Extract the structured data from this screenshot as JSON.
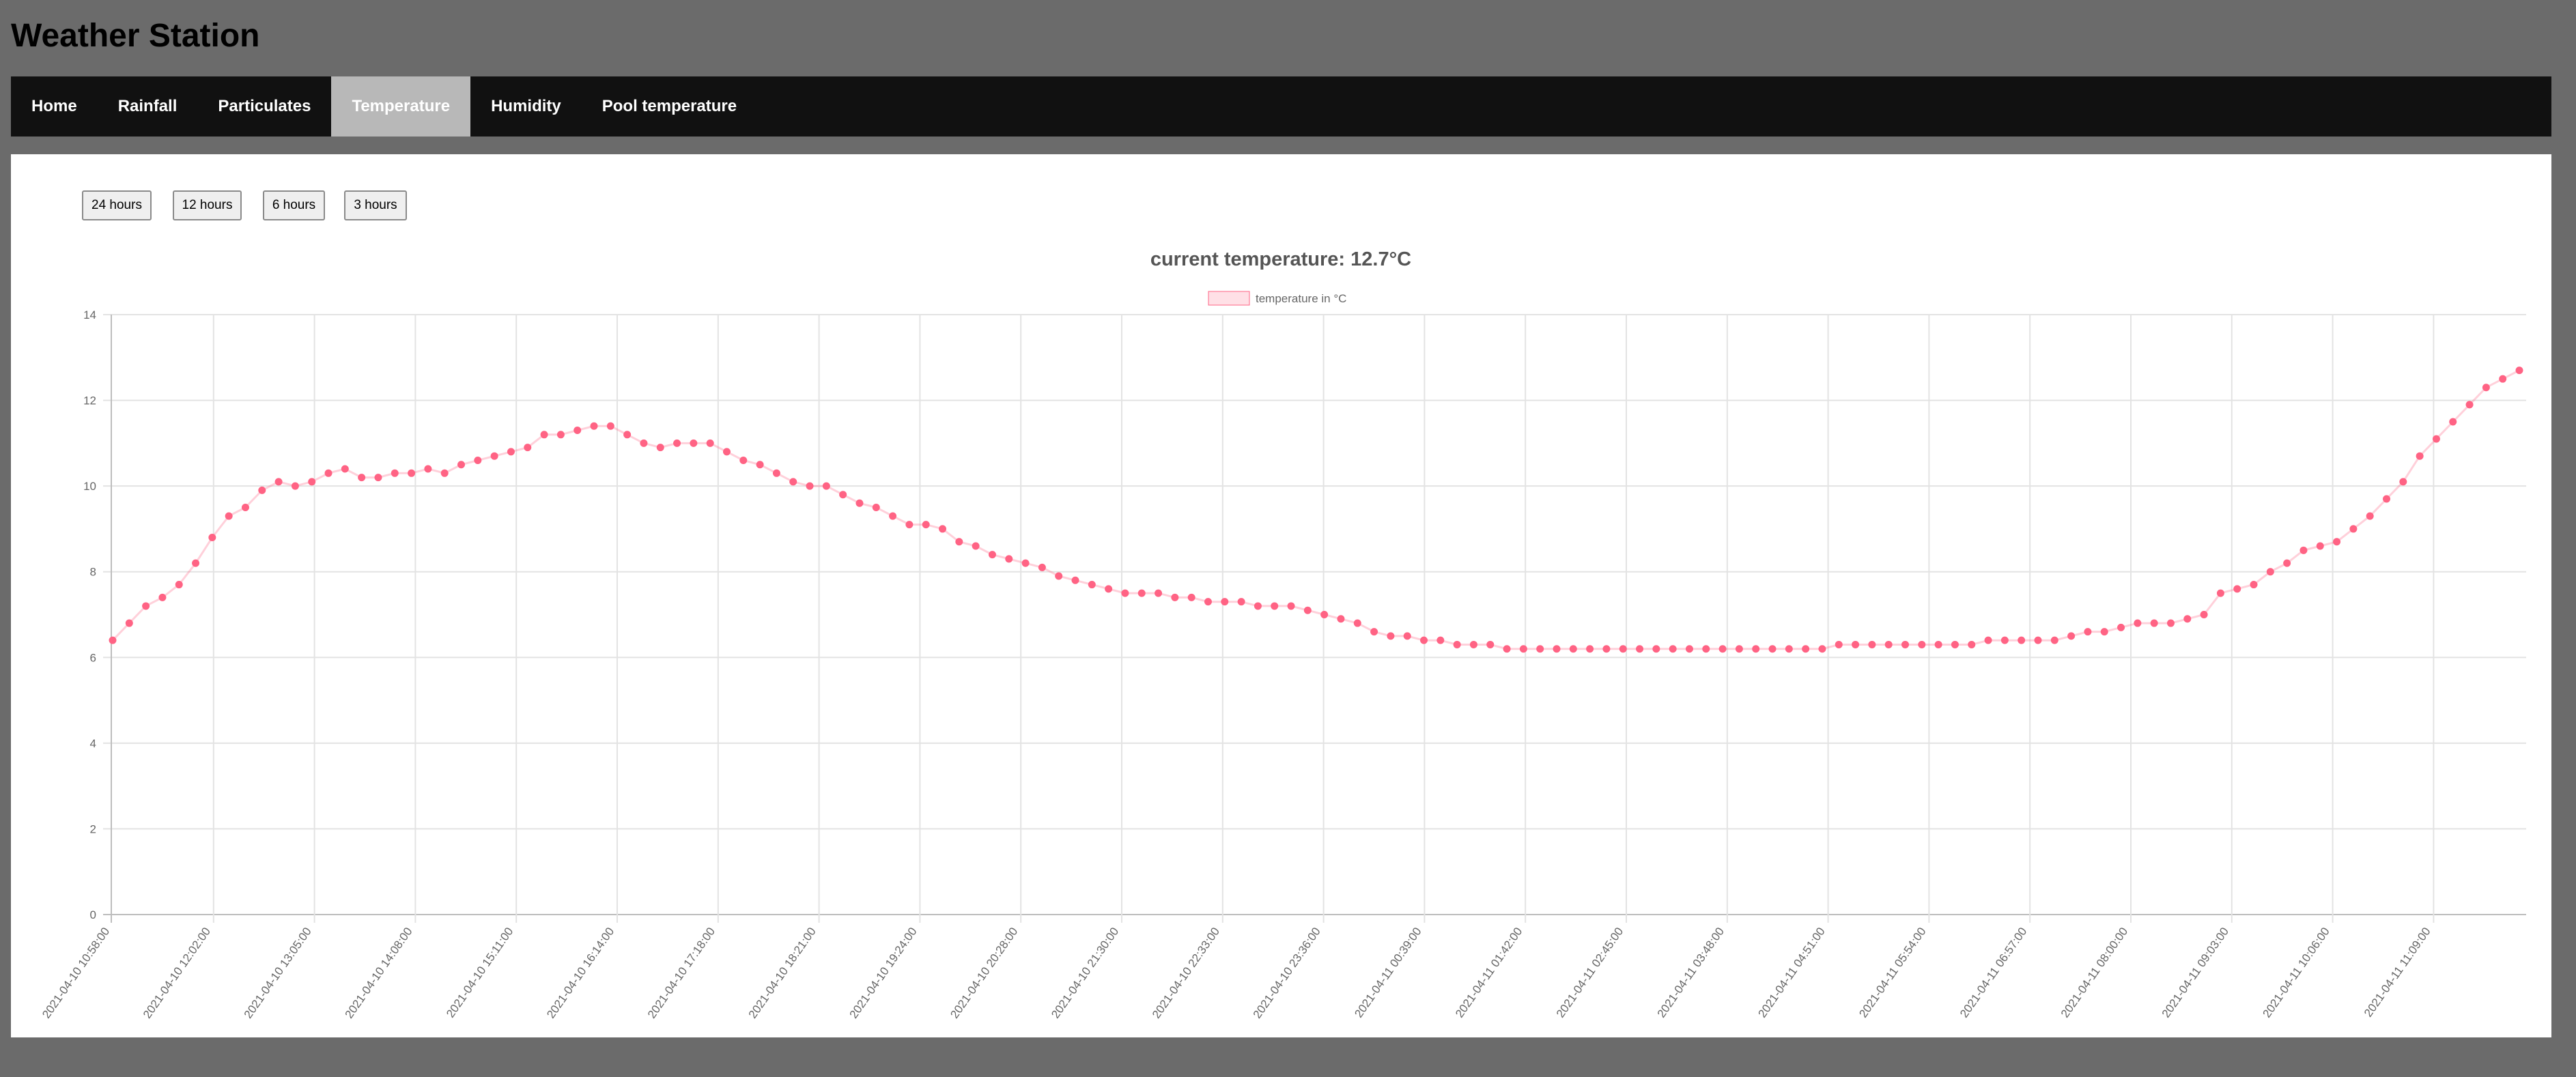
{
  "app": {
    "title": "Weather Station"
  },
  "nav": {
    "items": [
      "Home",
      "Rainfall",
      "Particulates",
      "Temperature",
      "Humidity",
      "Pool temperature"
    ],
    "active_index": 3
  },
  "range_buttons": [
    "24 hours",
    "12 hours",
    "6 hours",
    "3 hours"
  ],
  "colors": {
    "background": "#6b6b6b",
    "navbar": "#111111",
    "nav_active": "#b8b8b8",
    "series": "#ff6384",
    "series_fill": "rgba(255,99,132,0.2)"
  },
  "chart_data": {
    "type": "line",
    "title": "current temperature: 12.7°C",
    "legend": "temperature in °C",
    "legend_position": "top",
    "grid": true,
    "ylim": [
      0,
      14
    ],
    "y_ticks": [
      0,
      2,
      4,
      6,
      8,
      10,
      12,
      14
    ],
    "x_tick_labels": [
      "2021-04-10 10:58:00",
      "2021-04-10 12:02:00",
      "2021-04-10 13:05:00",
      "2021-04-10 14:08:00",
      "2021-04-10 15:11:00",
      "2021-04-10 16:14:00",
      "2021-04-10 17:18:00",
      "2021-04-10 18:21:00",
      "2021-04-10 19:24:00",
      "2021-04-10 20:28:00",
      "2021-04-10 21:30:00",
      "2021-04-10 22:33:00",
      "2021-04-10 23:36:00",
      "2021-04-11 00:39:00",
      "2021-04-11 01:42:00",
      "2021-04-11 02:45:00",
      "2021-04-11 03:48:00",
      "2021-04-11 04:51:00",
      "2021-04-11 05:54:00",
      "2021-04-11 06:57:00",
      "2021-04-11 08:00:00",
      "2021-04-11 09:03:00",
      "2021-04-11 10:06:00",
      "2021-04-11 11:09:00"
    ],
    "series": [
      {
        "values": [
          6.4,
          6.8,
          7.2,
          7.4,
          7.7,
          8.2,
          8.8,
          9.3,
          9.5,
          9.9,
          10.1,
          10.0,
          10.1,
          10.3,
          10.4,
          10.2,
          10.2,
          10.3,
          10.3,
          10.4,
          10.3,
          10.5,
          10.6,
          10.7,
          10.8,
          10.9,
          11.2,
          11.2,
          11.3,
          11.4,
          11.4,
          11.2,
          11.0,
          10.9,
          11.0,
          11.0,
          11.0,
          10.8,
          10.6,
          10.5,
          10.3,
          10.1,
          10.0,
          10.0,
          9.8,
          9.6,
          9.5,
          9.3,
          9.1,
          9.1,
          9.0,
          8.7,
          8.6,
          8.4,
          8.3,
          8.2,
          8.1,
          7.9,
          7.8,
          7.7,
          7.6,
          7.5,
          7.5,
          7.5,
          7.4,
          7.4,
          7.3,
          7.3,
          7.3,
          7.2,
          7.2,
          7.2,
          7.1,
          7.0,
          6.9,
          6.8,
          6.6,
          6.5,
          6.5,
          6.4,
          6.4,
          6.3,
          6.3,
          6.3,
          6.2,
          6.2,
          6.2,
          6.2,
          6.2,
          6.2,
          6.2,
          6.2,
          6.2,
          6.2,
          6.2,
          6.2,
          6.2,
          6.2,
          6.2,
          6.2,
          6.2,
          6.2,
          6.2,
          6.2,
          6.3,
          6.3,
          6.3,
          6.3,
          6.3,
          6.3,
          6.3,
          6.3,
          6.3,
          6.4,
          6.4,
          6.4,
          6.4,
          6.4,
          6.5,
          6.6,
          6.6,
          6.7,
          6.8,
          6.8,
          6.8,
          6.9,
          7.0,
          7.5,
          7.6,
          7.7,
          8.0,
          8.2,
          8.5,
          8.6,
          8.7,
          9.0,
          9.3,
          9.7,
          10.1,
          10.7,
          11.1,
          11.5,
          11.9,
          12.3,
          12.5,
          12.7
        ]
      }
    ]
  }
}
